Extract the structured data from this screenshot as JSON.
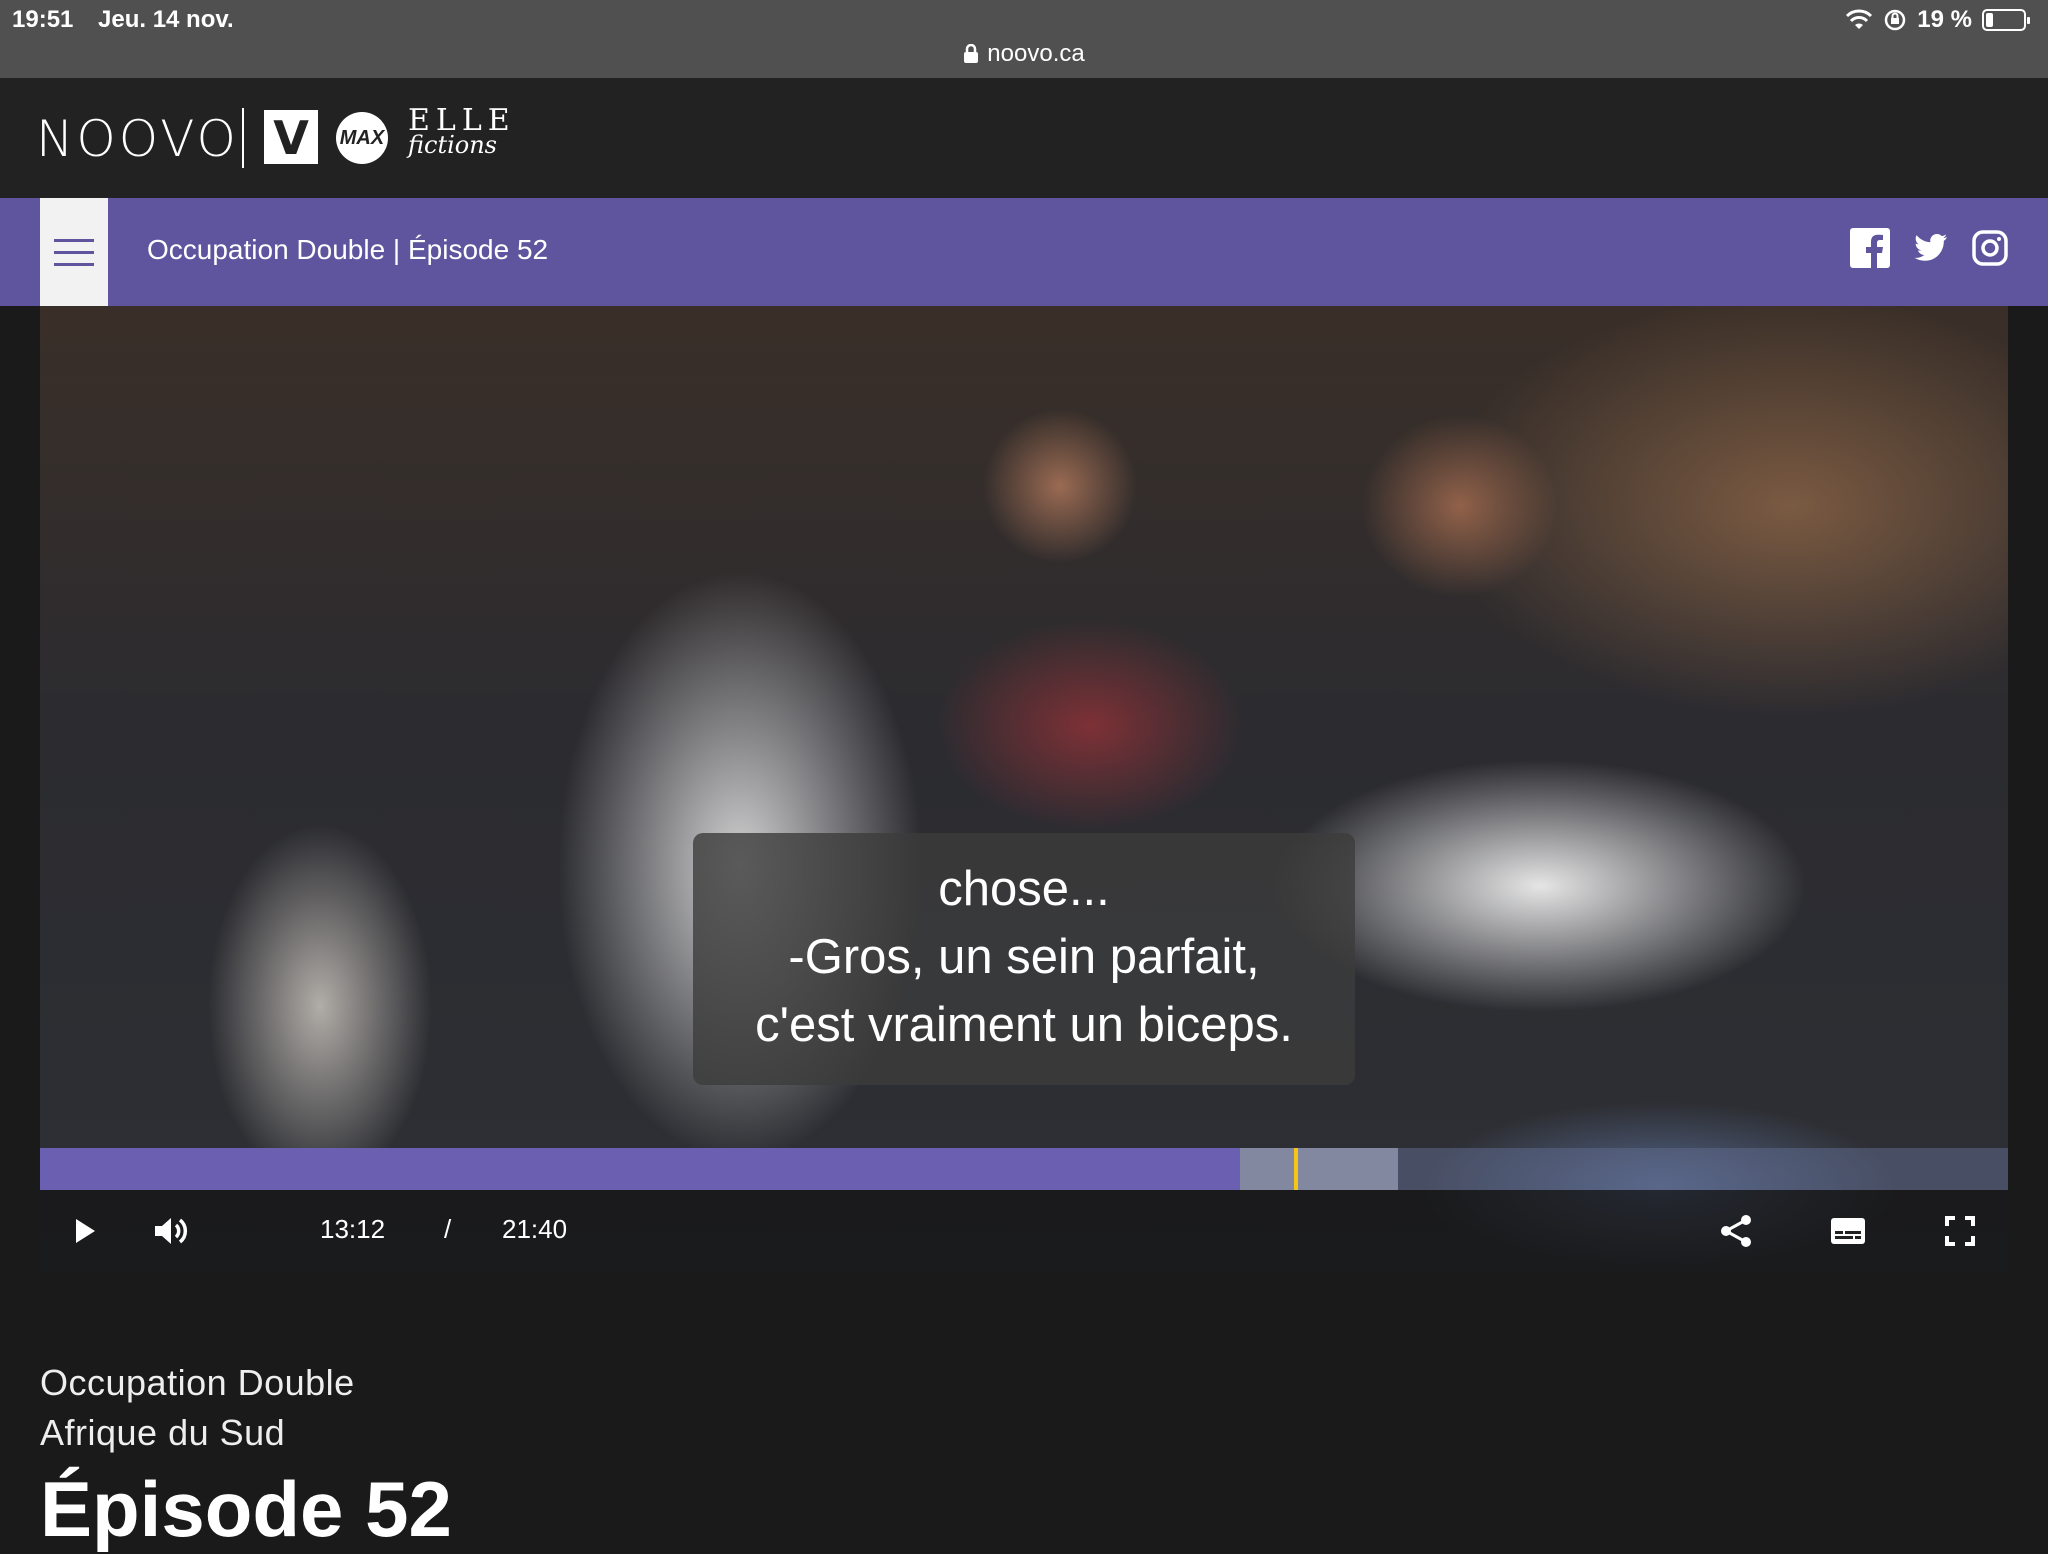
{
  "status_bar": {
    "time": "19:51",
    "date": "Jeu. 14 nov.",
    "battery": "19 %",
    "battery_level": 0.19,
    "url": "noovo.ca"
  },
  "brands": {
    "noovo": "NOOVO",
    "v": "V",
    "max": "MAX",
    "elle_top": "ELLE",
    "elle_bottom": "fictions"
  },
  "nav": {
    "title": "Occupation Double | Épisode 52",
    "social": [
      "facebook-icon",
      "twitter-icon",
      "instagram-icon"
    ]
  },
  "player": {
    "subtitle_lines": [
      "chose...",
      "-Gros, un sein parfait,",
      "c'est vraiment un biceps."
    ],
    "current_time": "13:12",
    "separator": "/",
    "duration": "21:40",
    "played_fraction": 0.61,
    "buffered_fraction": 0.69,
    "marker_fraction": 0.637,
    "accent": "#6a5fb0",
    "marker_color": "#f5c518"
  },
  "meta": {
    "show": "Occupation Double",
    "season": "Afrique du Sud",
    "episode": "Épisode 52"
  }
}
